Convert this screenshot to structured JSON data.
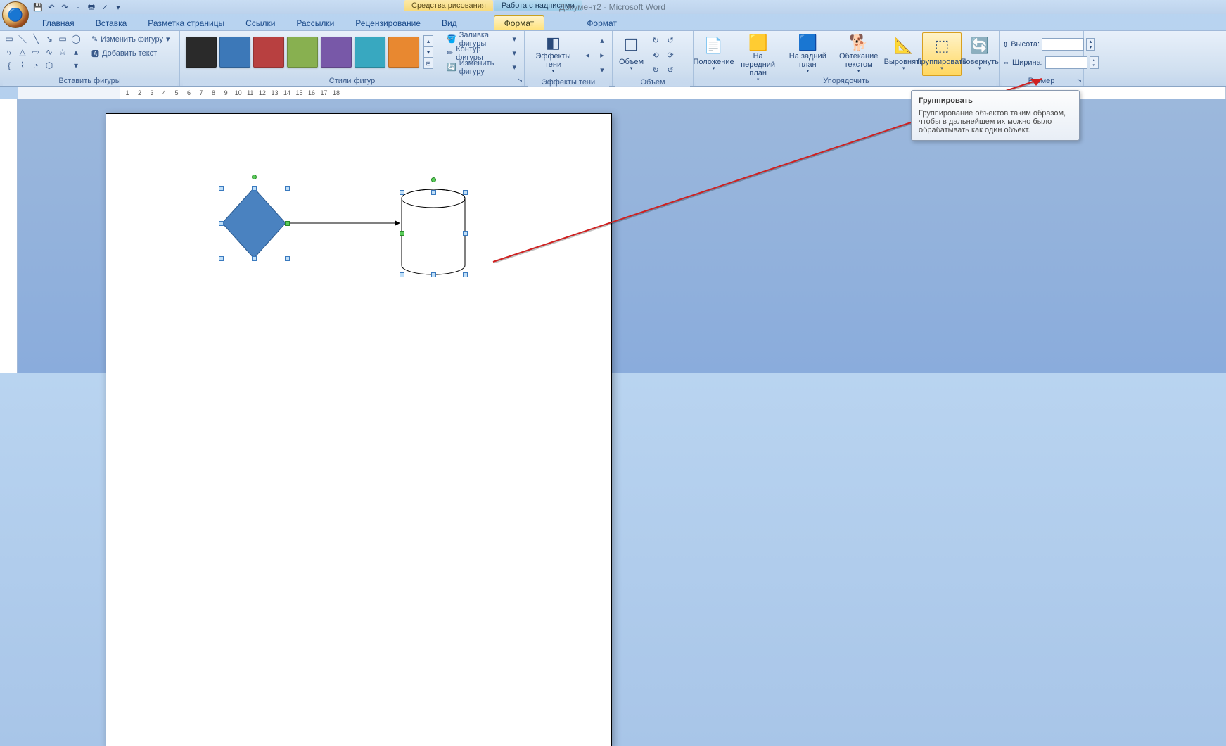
{
  "title": "Документ2 - Microsoft Word",
  "context_tabs": {
    "drawing": "Средства рисования",
    "textbox": "Работа с надписями"
  },
  "tabs": {
    "items": [
      "Главная",
      "Вставка",
      "Разметка страницы",
      "Ссылки",
      "Рассылки",
      "Рецензирование",
      "Вид",
      "Формат",
      "Формат"
    ],
    "active_index": 7
  },
  "groups": {
    "insert_shapes": {
      "label": "Вставить фигуры",
      "edit_shape": "Изменить фигуру",
      "add_text": "Добавить текст"
    },
    "shape_styles": {
      "label": "Стили фигур",
      "fill": "Заливка фигуры",
      "outline": "Контур фигуры",
      "change": "Изменить фигуру",
      "colors": [
        "#2a2a2a",
        "#3c78b8",
        "#b84040",
        "#88b050",
        "#7858a8",
        "#38a8c0",
        "#e88830"
      ]
    },
    "shadow": {
      "label": "Эффекты тени",
      "btn": "Эффекты тени"
    },
    "volume": {
      "label": "Объем",
      "btn": "Объем"
    },
    "arrange": {
      "label": "Упорядочить",
      "position": "Положение",
      "front": "На передний план",
      "back": "На задний план",
      "wrap": "Обтекание текстом",
      "align": "Выровнять",
      "group": "Группировать",
      "rotate": "Повернуть"
    },
    "size": {
      "label": "Размер",
      "height": "Высота:",
      "width": "Ширина:",
      "h_val": "",
      "w_val": ""
    }
  },
  "tooltip": {
    "title": "Группировать",
    "body": "Группирование объектов таким образом, чтобы в дальнейшем их можно было обрабатывать как один объект."
  }
}
